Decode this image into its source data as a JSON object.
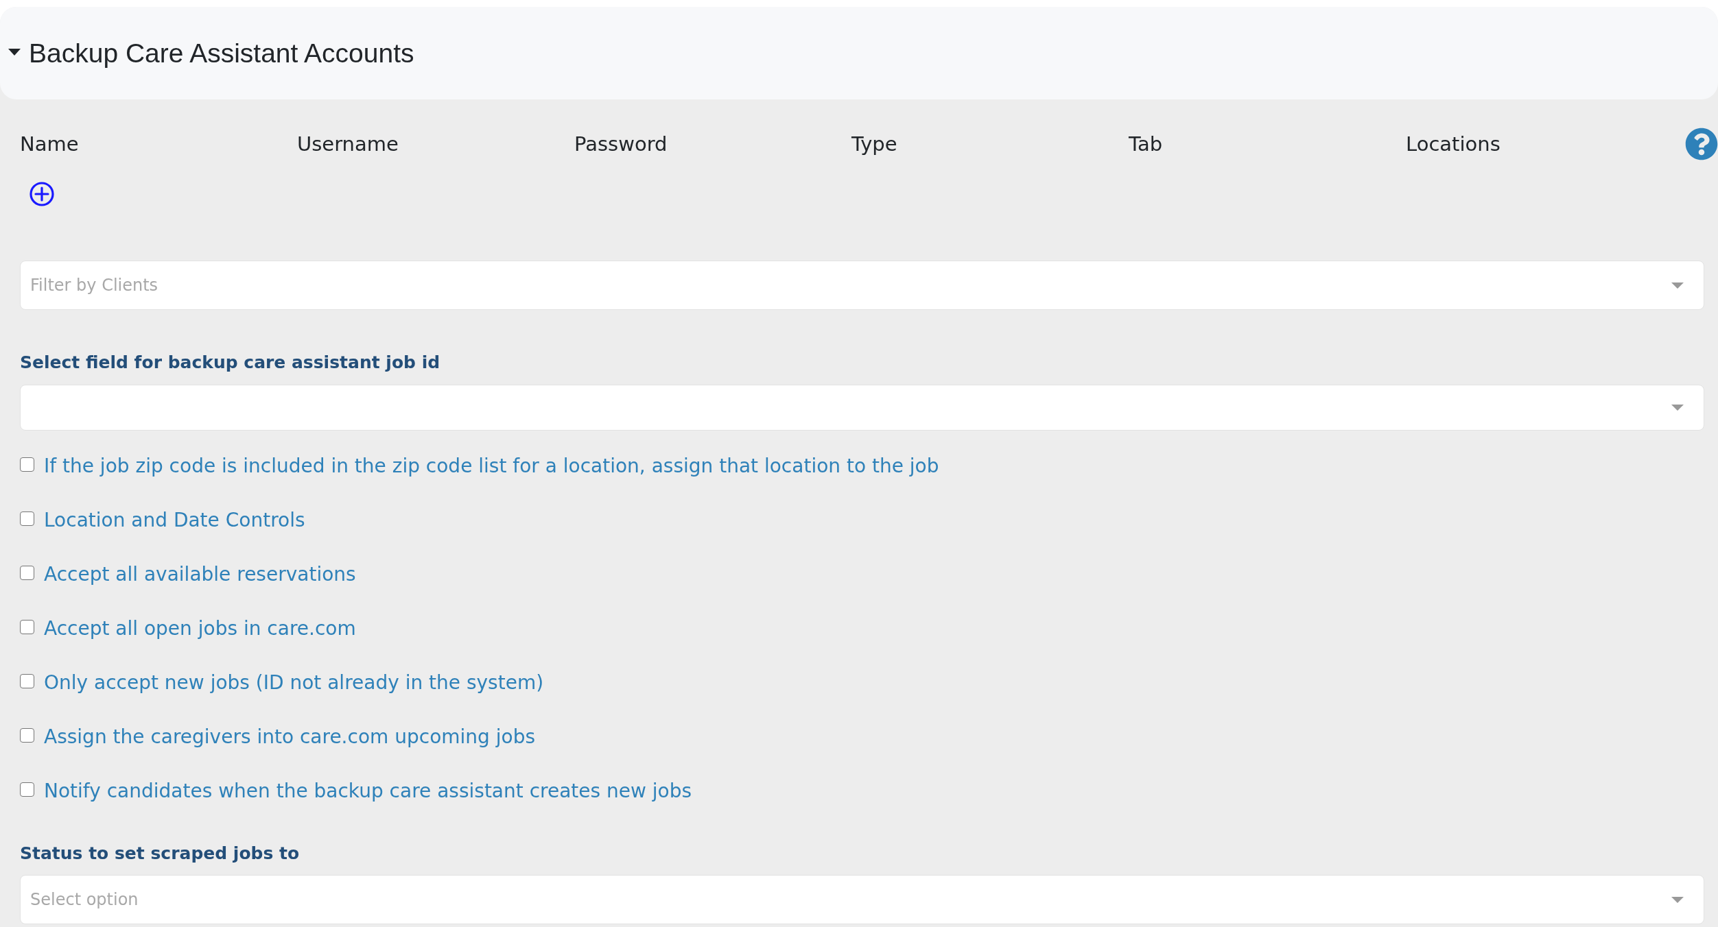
{
  "section": {
    "title": "Backup Care Assistant Accounts",
    "expanded": true
  },
  "accounts_table": {
    "columns": [
      "Name",
      "Username",
      "Password",
      "Type",
      "Tab",
      "Locations"
    ]
  },
  "client_filter": {
    "placeholder": "Filter by Clients"
  },
  "job_id_field": {
    "label": "Select field for backup care assistant job id"
  },
  "options": [
    {
      "label": "If the job zip code is included in the zip code list for a location, assign that location to the job",
      "checked": false
    },
    {
      "label": "Location and Date Controls",
      "checked": false
    },
    {
      "label": "Accept all available reservations",
      "checked": false
    },
    {
      "label": "Accept all open jobs in care.com",
      "checked": false
    },
    {
      "label": "Only accept new jobs (ID not already in the system)",
      "checked": false
    },
    {
      "label": "Assign the caregivers into care.com upcoming jobs",
      "checked": false
    },
    {
      "label": "Notify candidates when the backup care assistant creates new jobs",
      "checked": false
    }
  ],
  "status_field": {
    "label": "Status to set scraped jobs to",
    "placeholder": "Select option"
  }
}
